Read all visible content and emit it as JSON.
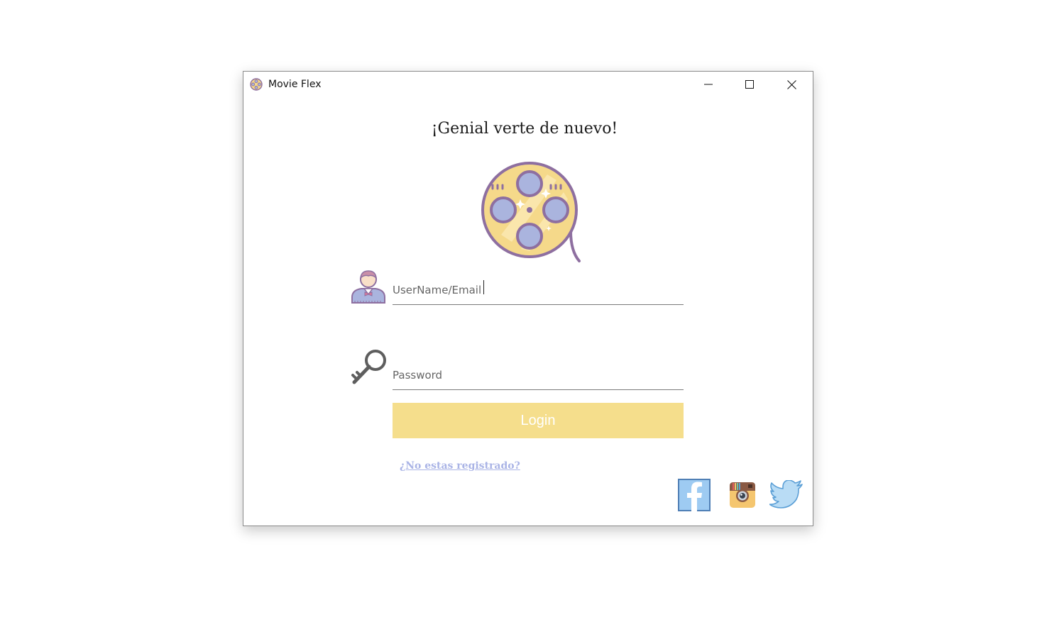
{
  "window": {
    "title": "Movie Flex",
    "app_icon": "film-reel-icon",
    "controls": {
      "minimize_icon": "minimize-icon",
      "maximize_icon": "maximize-icon",
      "close_icon": "close-icon"
    }
  },
  "login": {
    "heading": "¡Genial verte de nuevo!",
    "logo_icon": "film-reel-icon",
    "username": {
      "icon": "user-icon",
      "placeholder": "UserName/Email",
      "value": ""
    },
    "password": {
      "icon": "key-icon",
      "placeholder": "Password",
      "value": ""
    },
    "login_label": "Login",
    "register_link": "¿No estas registrado?"
  },
  "social": [
    {
      "name": "facebook",
      "icon": "facebook-icon"
    },
    {
      "name": "instagram",
      "icon": "instagram-icon"
    },
    {
      "name": "twitter",
      "icon": "twitter-icon"
    }
  ],
  "colors": {
    "accent_button": "#f5de8c",
    "link": "#aab4e6",
    "reel_outline": "#8e6fa0",
    "reel_fill": "#f5d98a",
    "reel_holes": "#aab4de"
  }
}
